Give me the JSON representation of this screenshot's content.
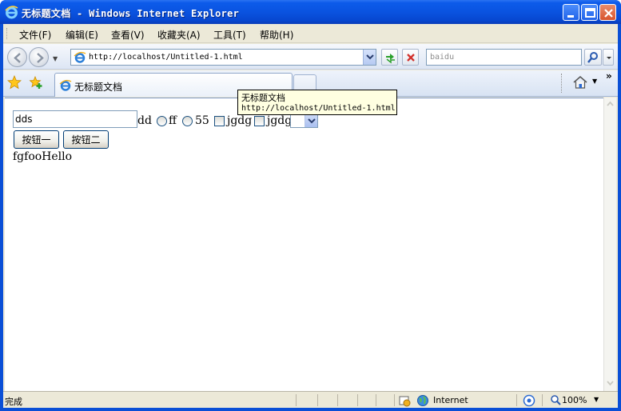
{
  "window": {
    "title": "无标题文档 - Windows Internet Explorer"
  },
  "menu": {
    "items": [
      "文件(F)",
      "编辑(E)",
      "查看(V)",
      "收藏夹(A)",
      "工具(T)",
      "帮助(H)"
    ]
  },
  "address_bar": {
    "url": "http://localhost/Untitled-1.html"
  },
  "search_box": {
    "value": "baidu"
  },
  "tab": {
    "title": "无标题文档",
    "overflow_glyph": "»"
  },
  "tooltip": {
    "title": "无标题文档",
    "url": "http://localhost/Untitled-1.html"
  },
  "page": {
    "text_input_value": "dds",
    "label_after_input": "dd",
    "radio_labels": [
      "ff",
      "55"
    ],
    "checkbox_labels": [
      "jgdg",
      "jgdg"
    ],
    "button1_label": "按钮一",
    "button2_label": "按钮二",
    "output_text": "fgfooHello"
  },
  "status_bar": {
    "text": "完成",
    "zone": "Internet",
    "zoom": "100%"
  },
  "colors": {
    "title_bar": "#0a53e0",
    "chrome": "#ece9d8",
    "tooltip_bg": "#ffffe1"
  }
}
